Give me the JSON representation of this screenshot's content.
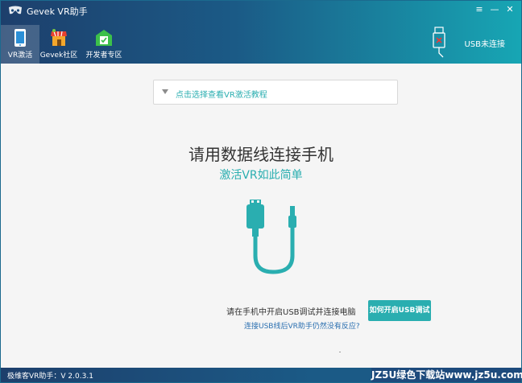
{
  "window": {
    "title": "Gevek VR助手"
  },
  "window_controls": {
    "menu": "≡",
    "minimize": "—",
    "close": "✕"
  },
  "nav": {
    "items": [
      {
        "label": "VR激活",
        "icon": "phone-icon",
        "active": true
      },
      {
        "label": "Gevek社区",
        "icon": "store-icon",
        "active": false
      },
      {
        "label": "开发者专区",
        "icon": "gift-box-icon",
        "active": false
      }
    ]
  },
  "usb": {
    "status_text": "USB未连接",
    "icon": "usb-disconnected-icon"
  },
  "tutorial": {
    "text": "点击选择查看VR激活教程"
  },
  "main": {
    "title": "请用数据线连接手机",
    "subtitle": "激活VR如此简单",
    "illustration": "usb-cable-icon",
    "instruction": "请在手机中开启USB调试并连接电脑",
    "howto_button": "如何开启USB调试",
    "help_link": "连接USB线后VR助手仍然没有反应?"
  },
  "footer": {
    "version": "极维客VR助手：V  2.0.3.1",
    "watermark": "JZ5U绿色下载站www.jz5u.com"
  },
  "colors": {
    "accent": "#2aaeb0",
    "header_dark": "#1d3f6c",
    "header_light": "#17a6b4",
    "link": "#2a6fb0"
  }
}
